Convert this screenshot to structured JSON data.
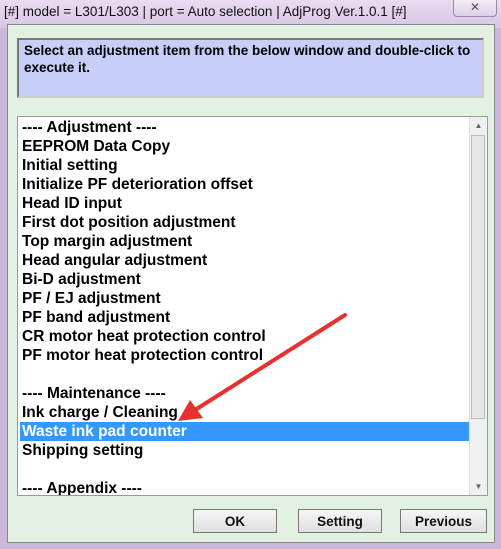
{
  "window": {
    "title": "[#] model = L301/L303 | port = Auto selection | AdjProg Ver.1.0.1 [#]",
    "close_icon": "close-icon"
  },
  "instruction": "Select an adjustment item from the below window and double-click to execute it.",
  "list": {
    "items": [
      "---- Adjustment ----",
      "EEPROM Data Copy",
      "Initial setting",
      "Initialize PF deterioration offset",
      "Head ID input",
      "First dot position adjustment",
      "Top margin adjustment",
      "Head angular adjustment",
      "Bi-D adjustment",
      "PF / EJ adjustment",
      "PF band adjustment",
      "CR motor heat protection control",
      "PF motor heat protection control",
      "",
      "---- Maintenance ----",
      "Ink charge / Cleaning",
      "Waste ink pad counter",
      "Shipping setting",
      "",
      "---- Appendix ----"
    ],
    "selected": "Waste ink pad counter",
    "selected_color": "#3399ff"
  },
  "buttons": {
    "ok": "OK",
    "setting": "Setting",
    "previous": "Previous"
  },
  "annotation": {
    "arrow_color": "#e83030"
  }
}
